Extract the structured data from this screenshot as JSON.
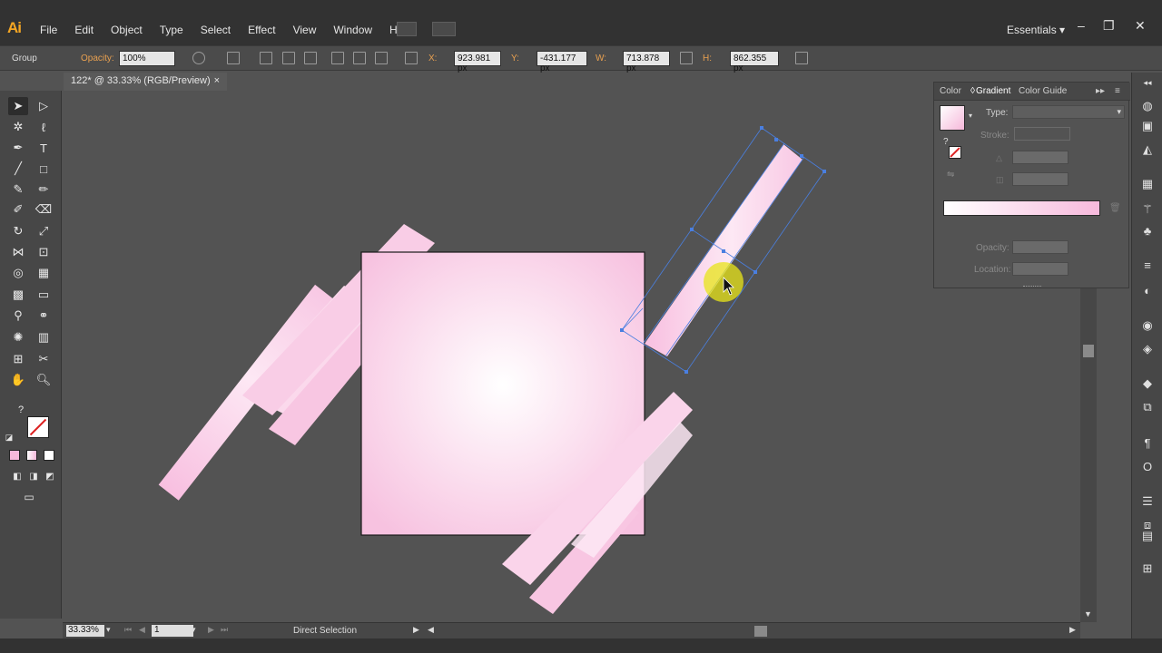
{
  "app": {
    "logo": "Ai",
    "menu": [
      "File",
      "Edit",
      "Object",
      "Type",
      "Select",
      "Effect",
      "View",
      "Window",
      "Help"
    ],
    "workspace": "Essentials"
  },
  "controlbar": {
    "selection_type": "Group",
    "opacity_label": "Opacity:",
    "opacity_value": "100%",
    "x_label": "X:",
    "x_value": "923.981 px",
    "y_label": "Y:",
    "y_value": "-431.177 px",
    "w_label": "W:",
    "w_value": "713.878 px",
    "h_label": "H:",
    "h_value": "862.355 px"
  },
  "document": {
    "tab_title": "122* @ 33.33% (RGB/Preview)"
  },
  "statusbar": {
    "zoom": "33.33%",
    "artboard": "1",
    "mode": "Direct Selection"
  },
  "gradient_panel": {
    "tabs": [
      "Color",
      "Gradient",
      "Color Guide"
    ],
    "active_tab": "Gradient",
    "type_label": "Type:",
    "stroke_label": "Stroke:",
    "opacity_label": "Opacity:",
    "location_label": "Location:",
    "gradient_start_color": "#ffffff",
    "gradient_end_color": "#f7b9dc"
  },
  "colors": {
    "accent": "#f5a623",
    "artwork_pink": "#f9c4e0",
    "selection_blue": "#4a7fe0"
  }
}
